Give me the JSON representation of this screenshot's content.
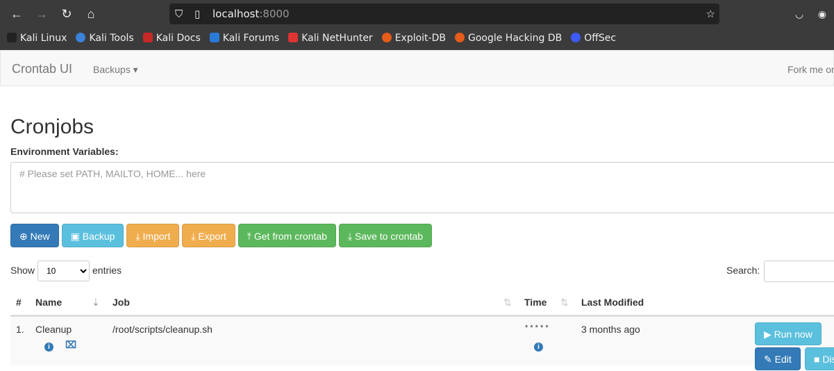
{
  "browser": {
    "url_host": "localhost",
    "url_port": ":8000",
    "bookmarks": [
      "Kali Linux",
      "Kali Tools",
      "Kali Docs",
      "Kali Forums",
      "Kali NetHunter",
      "Exploit-DB",
      "Google Hacking DB",
      "OffSec"
    ]
  },
  "navbar": {
    "brand": "Crontab UI",
    "backups": "Backups ▾",
    "fork": "Fork me on GitHub"
  },
  "page": {
    "title": "Cronjobs",
    "env_label": "Environment Variables:",
    "env_placeholder": "# Please set PATH, MAILTO, HOME... here"
  },
  "toolbar": {
    "new": "New",
    "backup": "Backup",
    "import": "Import",
    "export": "Export",
    "get": "Get from crontab",
    "save": "Save to crontab"
  },
  "table_controls": {
    "show": "Show",
    "page_size": "10",
    "entries": "entries",
    "search": "Search:"
  },
  "table": {
    "headers": [
      "#",
      "Name",
      "Job",
      "Time",
      "Last Modified"
    ],
    "rows": [
      {
        "index": "1.",
        "name": "Cleanup",
        "job": "/root/scripts/cleanup.sh",
        "time": "* * * * *",
        "modified": "3 months ago",
        "run": "Run now",
        "edit": "Edit",
        "disable": "Disable"
      }
    ]
  }
}
